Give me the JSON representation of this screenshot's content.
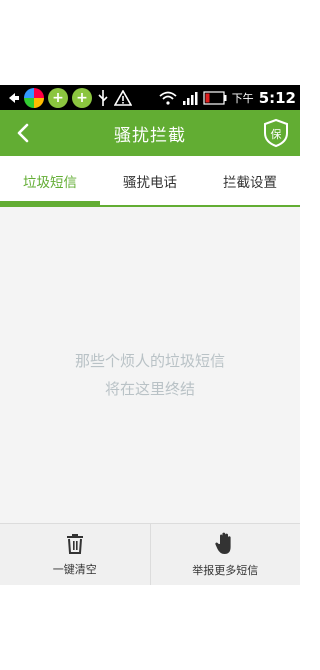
{
  "status_bar": {
    "ampm": "下午",
    "time": "5:12"
  },
  "header": {
    "title": "骚扰拦截",
    "back_icon": "back-arrow-icon",
    "shield_icon": "shield-icon",
    "shield_label": "保"
  },
  "tabs": [
    {
      "label": "垃圾短信",
      "active": true
    },
    {
      "label": "骚扰电话",
      "active": false
    },
    {
      "label": "拦截设置",
      "active": false
    }
  ],
  "empty_state": {
    "line1": "那些个烦人的垃圾短信",
    "line2": "将在这里终结"
  },
  "bottom_bar": {
    "clear_label": "一键清空",
    "clear_icon": "trash-icon",
    "report_label": "举报更多短信",
    "report_icon": "hand-icon"
  },
  "colors": {
    "accent": "#62ad33",
    "empty_text": "#b9c2c6"
  }
}
